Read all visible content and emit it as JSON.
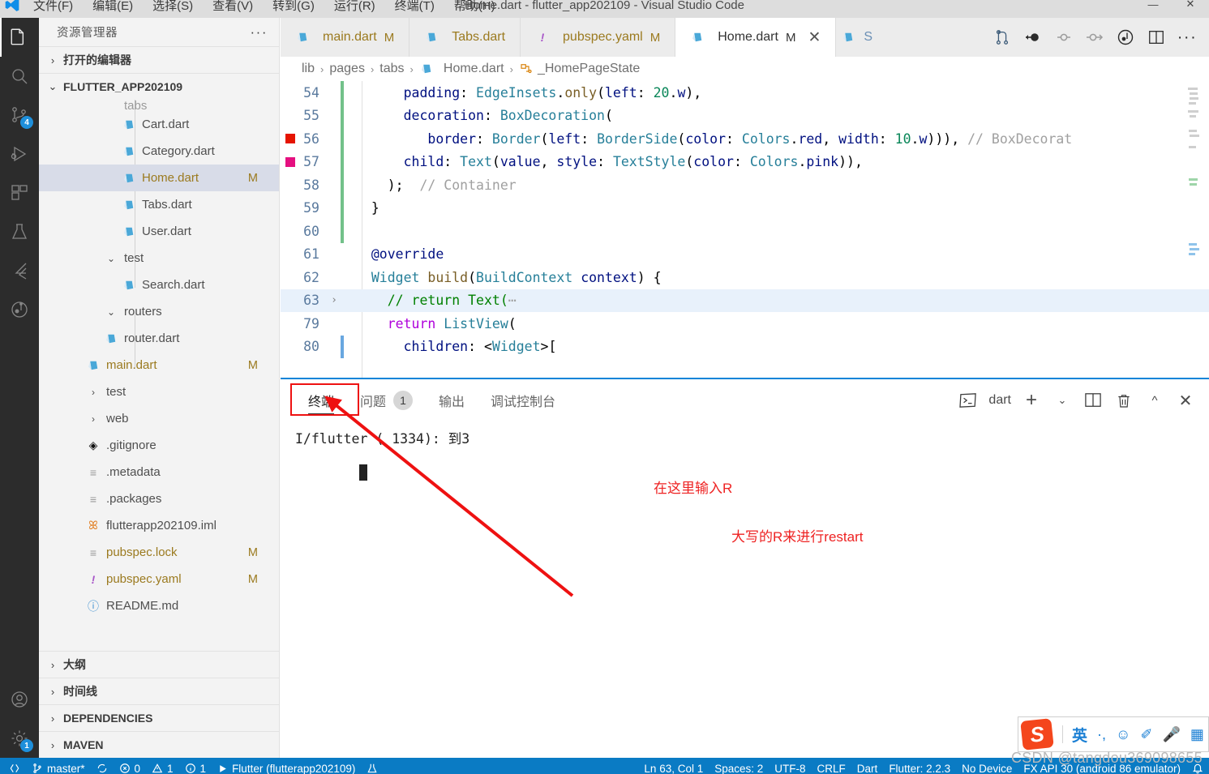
{
  "window": {
    "title": "Home.dart - flutter_app202109 - Visual Studio Code",
    "menu": [
      "文件(F)",
      "编辑(E)",
      "选择(S)",
      "查看(V)",
      "转到(G)",
      "运行(R)",
      "终端(T)",
      "帮助(H)"
    ],
    "controls": {
      "minimize": "—",
      "maximize": "▢",
      "close": "✕"
    }
  },
  "activitybar": {
    "items": [
      {
        "name": "explorer",
        "icon": "files-icon",
        "badge": ""
      },
      {
        "name": "search",
        "icon": "search-icon",
        "badge": ""
      },
      {
        "name": "source-control",
        "icon": "source-control-icon",
        "badge": "4"
      },
      {
        "name": "run-and-debug",
        "icon": "run-debug-icon",
        "badge": ""
      },
      {
        "name": "extensions",
        "icon": "extensions-icon",
        "badge": ""
      },
      {
        "name": "testing",
        "icon": "beaker-icon",
        "badge": ""
      },
      {
        "name": "flutter",
        "icon": "flutter-icon",
        "badge": ""
      },
      {
        "name": "dart-devtools",
        "icon": "dart-graph-icon",
        "badge": ""
      }
    ],
    "bottom": [
      {
        "name": "accounts",
        "icon": "account-icon",
        "badge": ""
      },
      {
        "name": "settings",
        "icon": "gear-icon",
        "badge": "1"
      }
    ]
  },
  "sidebar": {
    "title": "资源管理器",
    "more_label": "···",
    "open_editors": {
      "label": "打开的编辑器",
      "chevron": "›"
    },
    "project": {
      "label": "FLUTTER_APP202109",
      "chevron": "⌄"
    },
    "partial_row": {
      "label": "tabs"
    },
    "tree": [
      {
        "label": "Cart.dart",
        "icon": "dart-file-icon",
        "depth": 3,
        "flag": "",
        "selected": false,
        "type": "file"
      },
      {
        "label": "Category.dart",
        "icon": "dart-file-icon",
        "depth": 3,
        "flag": "",
        "selected": false,
        "type": "file"
      },
      {
        "label": "Home.dart",
        "icon": "dart-file-icon",
        "depth": 3,
        "flag": "M",
        "selected": true,
        "type": "file"
      },
      {
        "label": "Tabs.dart",
        "icon": "dart-file-icon",
        "depth": 3,
        "flag": "",
        "selected": false,
        "type": "file"
      },
      {
        "label": "User.dart",
        "icon": "dart-file-icon",
        "depth": 3,
        "flag": "",
        "selected": false,
        "type": "file"
      },
      {
        "label": "test",
        "icon": "chevron-down-icon",
        "depth": 2,
        "flag": "",
        "selected": false,
        "type": "folder-open"
      },
      {
        "label": "Search.dart",
        "icon": "dart-file-icon",
        "depth": 3,
        "flag": "",
        "selected": false,
        "type": "file"
      },
      {
        "label": "routers",
        "icon": "chevron-down-icon",
        "depth": 2,
        "flag": "",
        "selected": false,
        "type": "folder-open"
      },
      {
        "label": "router.dart",
        "icon": "dart-file-icon",
        "depth": 2,
        "flag": "",
        "selected": false,
        "type": "file"
      },
      {
        "label": "main.dart",
        "icon": "dart-file-icon",
        "depth": 1,
        "flag": "M",
        "selected": false,
        "type": "file"
      },
      {
        "label": "test",
        "icon": "chevron-right-icon",
        "depth": 1,
        "flag": "",
        "selected": false,
        "type": "folder"
      },
      {
        "label": "web",
        "icon": "chevron-right-icon",
        "depth": 1,
        "flag": "",
        "selected": false,
        "type": "folder"
      },
      {
        "label": ".gitignore",
        "icon": "git-icon",
        "depth": 1,
        "flag": "",
        "selected": false,
        "type": "file"
      },
      {
        "label": ".metadata",
        "icon": "lines-icon",
        "depth": 1,
        "flag": "",
        "selected": false,
        "type": "file"
      },
      {
        "label": ".packages",
        "icon": "lines-icon",
        "depth": 1,
        "flag": "",
        "selected": false,
        "type": "file"
      },
      {
        "label": "flutterapp202109.iml",
        "icon": "rss-icon",
        "depth": 1,
        "flag": "",
        "selected": false,
        "type": "file"
      },
      {
        "label": "pubspec.lock",
        "icon": "lines-icon",
        "depth": 1,
        "flag": "M",
        "selected": false,
        "type": "file"
      },
      {
        "label": "pubspec.yaml",
        "icon": "yaml-icon",
        "depth": 1,
        "flag": "M",
        "selected": false,
        "type": "file"
      },
      {
        "label": "README.md",
        "icon": "info-icon",
        "depth": 1,
        "flag": "",
        "selected": false,
        "type": "file"
      }
    ],
    "bottom_sections": [
      {
        "label": "大纲",
        "chevron": "›"
      },
      {
        "label": "时间线",
        "chevron": "›"
      },
      {
        "label": "DEPENDENCIES",
        "chevron": "›"
      },
      {
        "label": "MAVEN",
        "chevron": "›"
      }
    ]
  },
  "editor": {
    "tabs": [
      {
        "label": "main.dart",
        "icon": "dart-file-icon",
        "flag": "M",
        "active": false,
        "closable": false
      },
      {
        "label": "Tabs.dart",
        "icon": "dart-file-icon",
        "flag": "",
        "active": false,
        "closable": false
      },
      {
        "label": "pubspec.yaml",
        "icon": "yaml-icon",
        "flag": "M",
        "active": false,
        "closable": false
      },
      {
        "label": "Home.dart",
        "icon": "dart-file-icon",
        "flag": "M",
        "active": true,
        "closable": true
      }
    ],
    "tab_overflow": {
      "label": "S",
      "icon": "dart-file-icon"
    },
    "tab_actions": [
      "source-control-icon",
      "step-back-icon",
      "step-over-icon",
      "step-into-icon",
      "debug-icon",
      "split-editor-icon",
      "more-actions-icon"
    ],
    "close_label": "✕",
    "breadcrumb": [
      {
        "label": "lib",
        "icon": ""
      },
      {
        "label": "pages",
        "icon": ""
      },
      {
        "label": "tabs",
        "icon": ""
      },
      {
        "label": "Home.dart",
        "icon": "dart-file-icon"
      },
      {
        "label": "_HomePageState",
        "icon": "class-icon"
      }
    ],
    "breadcrumb_sep": "›",
    "lines": [
      {
        "num": "54",
        "change": "green",
        "bp": "",
        "fold": "",
        "highlight": false,
        "tokens": [
          {
            "t": "      ",
            "c": "plain"
          },
          {
            "t": "padding",
            "c": "prop"
          },
          {
            "t": ": ",
            "c": "plain"
          },
          {
            "t": "EdgeInsets",
            "c": "cls"
          },
          {
            "t": ".",
            "c": "plain"
          },
          {
            "t": "only",
            "c": "fn"
          },
          {
            "t": "(",
            "c": "plain"
          },
          {
            "t": "left",
            "c": "prop"
          },
          {
            "t": ": ",
            "c": "plain"
          },
          {
            "t": "20",
            "c": "num"
          },
          {
            "t": ".",
            "c": "plain"
          },
          {
            "t": "w",
            "c": "prop"
          },
          {
            "t": "),",
            "c": "plain"
          }
        ]
      },
      {
        "num": "55",
        "change": "green",
        "bp": "",
        "fold": "",
        "highlight": false,
        "tokens": [
          {
            "t": "      ",
            "c": "plain"
          },
          {
            "t": "decoration",
            "c": "prop"
          },
          {
            "t": ": ",
            "c": "plain"
          },
          {
            "t": "BoxDecoration",
            "c": "cls"
          },
          {
            "t": "(",
            "c": "plain"
          }
        ]
      },
      {
        "num": "56",
        "change": "green",
        "bp": "red",
        "fold": "",
        "highlight": false,
        "tokens": [
          {
            "t": "         ",
            "c": "plain"
          },
          {
            "t": "border",
            "c": "prop"
          },
          {
            "t": ": ",
            "c": "plain"
          },
          {
            "t": "Border",
            "c": "cls"
          },
          {
            "t": "(",
            "c": "plain"
          },
          {
            "t": "left",
            "c": "prop"
          },
          {
            "t": ": ",
            "c": "plain"
          },
          {
            "t": "BorderSide",
            "c": "cls"
          },
          {
            "t": "(",
            "c": "plain"
          },
          {
            "t": "color",
            "c": "prop"
          },
          {
            "t": ": ",
            "c": "plain"
          },
          {
            "t": "Colors",
            "c": "cls"
          },
          {
            "t": ".",
            "c": "plain"
          },
          {
            "t": "red",
            "c": "prop"
          },
          {
            "t": ", ",
            "c": "plain"
          },
          {
            "t": "width",
            "c": "prop"
          },
          {
            "t": ": ",
            "c": "plain"
          },
          {
            "t": "10",
            "c": "num"
          },
          {
            "t": ".",
            "c": "plain"
          },
          {
            "t": "w",
            "c": "prop"
          },
          {
            "t": "))), ",
            "c": "plain"
          },
          {
            "t": "// ",
            "c": "cmt2"
          },
          {
            "t": "BoxDecorat",
            "c": "cmt2"
          }
        ]
      },
      {
        "num": "57",
        "change": "green",
        "bp": "pink",
        "fold": "",
        "highlight": false,
        "tokens": [
          {
            "t": "      ",
            "c": "plain"
          },
          {
            "t": "child",
            "c": "prop"
          },
          {
            "t": ": ",
            "c": "plain"
          },
          {
            "t": "Text",
            "c": "cls"
          },
          {
            "t": "(",
            "c": "plain"
          },
          {
            "t": "value",
            "c": "prop"
          },
          {
            "t": ", ",
            "c": "plain"
          },
          {
            "t": "style",
            "c": "prop"
          },
          {
            "t": ": ",
            "c": "plain"
          },
          {
            "t": "TextStyle",
            "c": "cls"
          },
          {
            "t": "(",
            "c": "plain"
          },
          {
            "t": "color",
            "c": "prop"
          },
          {
            "t": ": ",
            "c": "plain"
          },
          {
            "t": "Colors",
            "c": "cls"
          },
          {
            "t": ".",
            "c": "plain"
          },
          {
            "t": "pink",
            "c": "prop"
          },
          {
            "t": ")),",
            "c": "plain"
          }
        ]
      },
      {
        "num": "58",
        "change": "green",
        "bp": "",
        "fold": "",
        "highlight": false,
        "tokens": [
          {
            "t": "    );  ",
            "c": "plain"
          },
          {
            "t": "// Container",
            "c": "cmt2"
          }
        ]
      },
      {
        "num": "59",
        "change": "green",
        "bp": "",
        "fold": "",
        "highlight": false,
        "tokens": [
          {
            "t": "  }",
            "c": "plain"
          }
        ]
      },
      {
        "num": "60",
        "change": "green",
        "bp": "",
        "fold": "",
        "highlight": false,
        "tokens": [
          {
            "t": "",
            "c": "plain"
          }
        ]
      },
      {
        "num": "61",
        "change": "none",
        "bp": "",
        "fold": "",
        "highlight": false,
        "tokens": [
          {
            "t": "  ",
            "c": "plain"
          },
          {
            "t": "@override",
            "c": "par"
          }
        ]
      },
      {
        "num": "62",
        "change": "none",
        "bp": "",
        "fold": "",
        "highlight": false,
        "tokens": [
          {
            "t": "  ",
            "c": "plain"
          },
          {
            "t": "Widget",
            "c": "cls"
          },
          {
            "t": " ",
            "c": "plain"
          },
          {
            "t": "build",
            "c": "fn"
          },
          {
            "t": "(",
            "c": "plain"
          },
          {
            "t": "BuildContext",
            "c": "cls"
          },
          {
            "t": " ",
            "c": "plain"
          },
          {
            "t": "context",
            "c": "par"
          },
          {
            "t": ") {",
            "c": "plain"
          }
        ]
      },
      {
        "num": "63",
        "change": "none",
        "bp": "",
        "fold": "›",
        "highlight": true,
        "tokens": [
          {
            "t": "    ",
            "c": "plain"
          },
          {
            "t": "// return Text(",
            "c": "cmt"
          },
          {
            "t": "⋯",
            "c": "cmt2"
          }
        ]
      },
      {
        "num": "79",
        "change": "none",
        "bp": "",
        "fold": "",
        "highlight": false,
        "tokens": [
          {
            "t": "    ",
            "c": "plain"
          },
          {
            "t": "return",
            "c": "kw2"
          },
          {
            "t": " ",
            "c": "plain"
          },
          {
            "t": "ListView",
            "c": "cls"
          },
          {
            "t": "(",
            "c": "plain"
          }
        ]
      },
      {
        "num": "80",
        "change": "blue",
        "bp": "",
        "fold": "",
        "highlight": false,
        "tokens": [
          {
            "t": "      ",
            "c": "plain"
          },
          {
            "t": "children",
            "c": "prop"
          },
          {
            "t": ": ",
            "c": "plain"
          },
          {
            "t": "<",
            "c": "plain"
          },
          {
            "t": "Widget",
            "c": "cls"
          },
          {
            "t": ">[",
            "c": "plain"
          }
        ]
      }
    ]
  },
  "panel": {
    "tabs": [
      {
        "label": "终端",
        "badge": "",
        "active": true
      },
      {
        "label": "问题",
        "badge": "1",
        "active": false
      },
      {
        "label": "输出",
        "badge": "",
        "active": false
      },
      {
        "label": "调试控制台",
        "badge": "",
        "active": false
      }
    ],
    "shell_label": "dart",
    "actions": [
      "terminal-icon",
      "new-terminal-icon",
      "chevron-down-icon",
      "split-terminal-icon",
      "kill-terminal-icon",
      "maximize-panel-icon",
      "close-panel-icon"
    ],
    "terminal_output": "I/flutter ( 1334): 到3",
    "cursor": "▌"
  },
  "annotations": [
    {
      "name": "terminal-tab-highlight",
      "type": "box",
      "text": ""
    },
    {
      "name": "arrow-to-terminal-tab",
      "type": "arrow",
      "text": ""
    },
    {
      "name": "hint-type-r-here",
      "type": "text",
      "text": "在这里输入R"
    },
    {
      "name": "hint-uppercase-restart",
      "type": "text",
      "text": "大写的R来进行restart"
    }
  ],
  "statusbar": {
    "left": [
      {
        "icon": "remote-icon",
        "label": ""
      },
      {
        "icon": "branch-icon",
        "label": "master*"
      },
      {
        "icon": "sync-icon",
        "label": ""
      },
      {
        "icon": "error-icon",
        "label": "0"
      },
      {
        "icon": "warning-icon",
        "label": "1"
      },
      {
        "icon": "info-icon",
        "label": "1"
      },
      {
        "icon": "flutter-run",
        "label": "Flutter (flutterapp202109)"
      },
      {
        "icon": "beaker-icon",
        "label": ""
      }
    ],
    "right": [
      {
        "label": "Ln 63, Col 1"
      },
      {
        "label": "Spaces: 2"
      },
      {
        "label": "UTF-8"
      },
      {
        "label": "CRLF"
      },
      {
        "label": "Dart"
      },
      {
        "label": "Flutter: 2.2.3"
      },
      {
        "label": "No Device"
      },
      {
        "label": "FX API 30 (android 86 emulator)"
      },
      {
        "icon": "bell-icon",
        "label": ""
      }
    ]
  },
  "ime": {
    "logo": "S",
    "mode": "英",
    "items": [
      "·,",
      "☺",
      "✐",
      "🎤",
      "▦"
    ]
  },
  "watermark": "CSDN @tangdou369098655"
}
